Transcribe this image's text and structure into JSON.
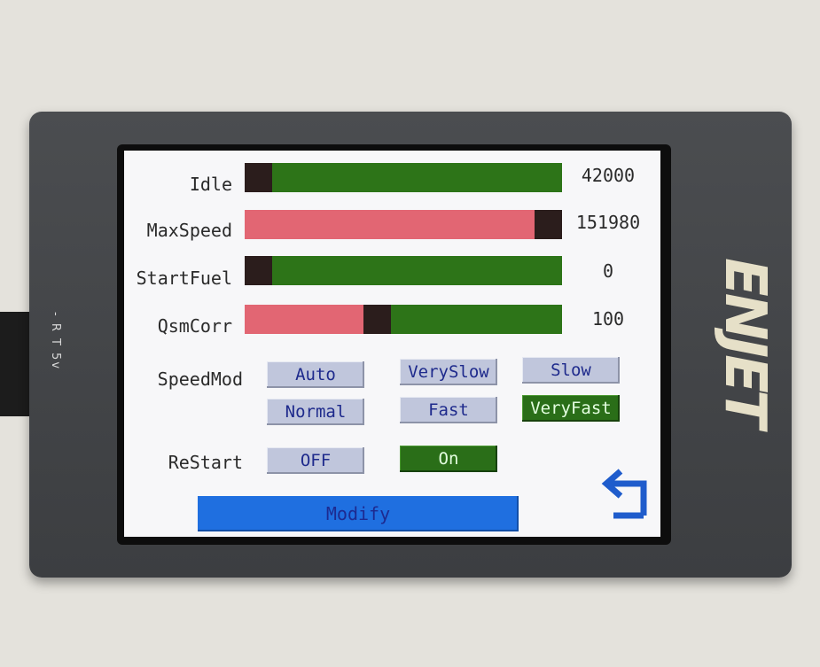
{
  "device": {
    "side_label": "- R T 5v",
    "brand": "ENJET"
  },
  "params": [
    {
      "label": "Idle",
      "value": "42000",
      "fill": 0.0
    },
    {
      "label": "MaxSpeed",
      "value": "151980",
      "fill": 1.0
    },
    {
      "label": "StartFuel",
      "value": "0",
      "fill": 0.0
    },
    {
      "label": "QsmCorr",
      "value": "100",
      "fill": 0.4
    }
  ],
  "speed_mode": {
    "label": "SpeedMod",
    "options": [
      "Auto",
      "VerySlow",
      "Slow",
      "Normal",
      "Fast",
      "VeryFast"
    ],
    "selected": "VeryFast"
  },
  "restart": {
    "label": "ReStart",
    "off_label": "OFF",
    "on_label": "On",
    "selected": "On"
  },
  "modify_label": "Modify",
  "colors": {
    "bar_green": "#2d7418",
    "bar_red": "#e26673",
    "bar_knob": "#2b1d1c",
    "button": "#c0c6dc",
    "button_selected": "#2a6e18",
    "modify": "#1f6fe0",
    "back_arrow": "#1f5ccc"
  },
  "icons": {
    "back": "back-arrow-icon"
  }
}
